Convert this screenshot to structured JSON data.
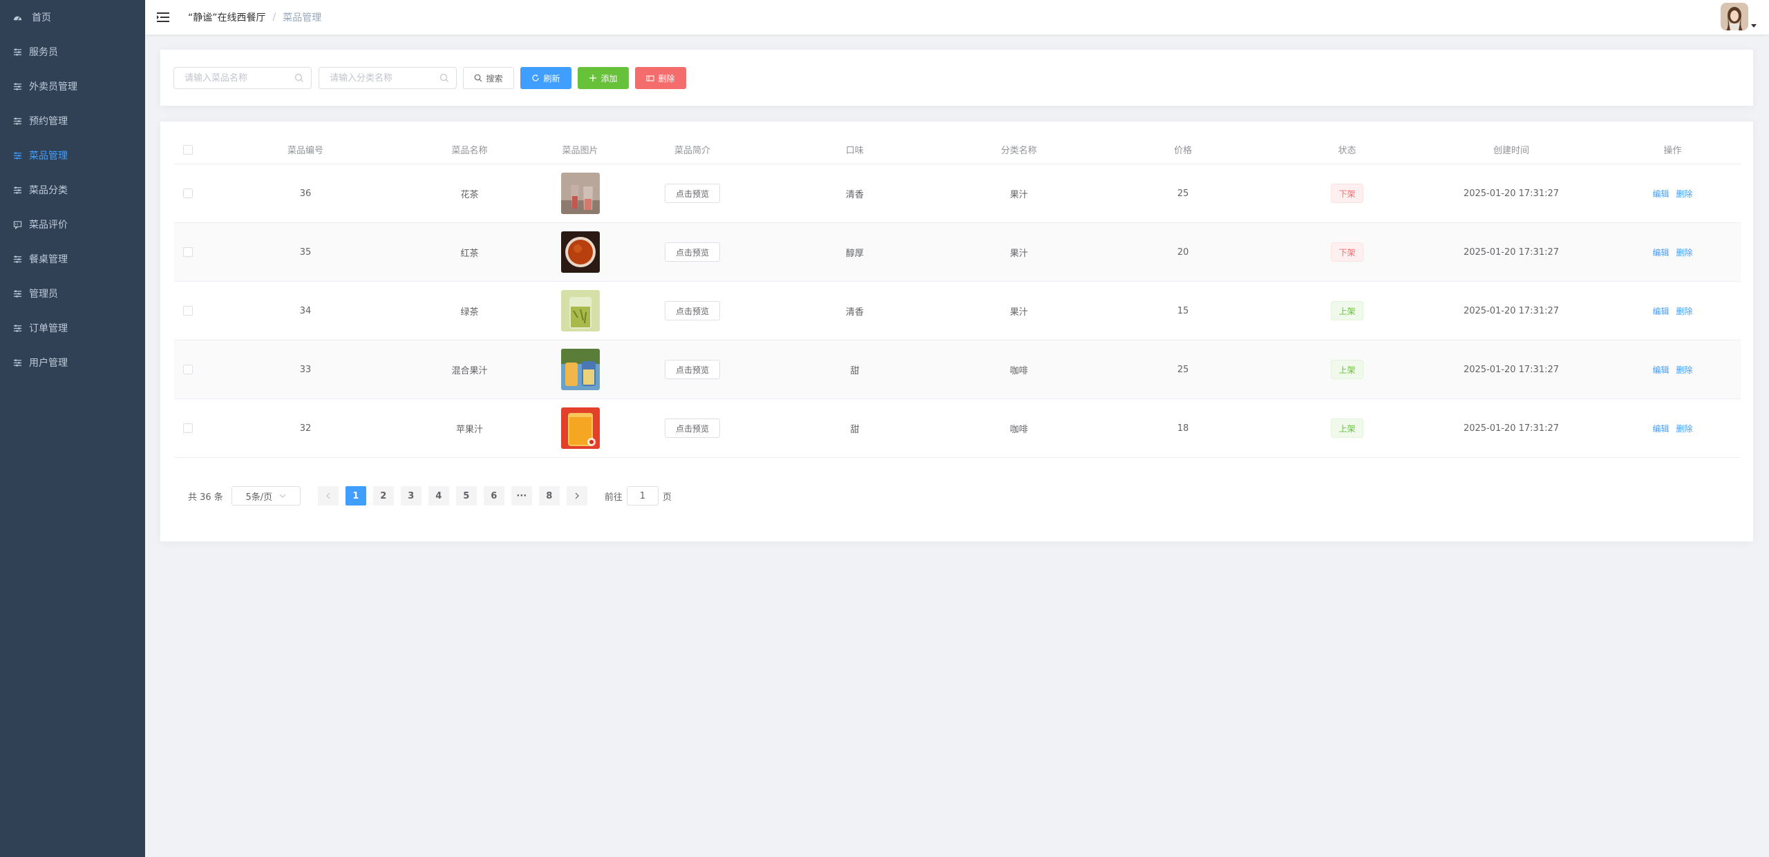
{
  "sidebar": {
    "items": [
      {
        "label": "首页",
        "icon": "dashboard-icon",
        "active": false
      },
      {
        "label": "服务员",
        "icon": "sliders-icon",
        "active": false
      },
      {
        "label": "外卖员管理",
        "icon": "sliders-icon",
        "active": false
      },
      {
        "label": "预约管理",
        "icon": "sliders-icon",
        "active": false
      },
      {
        "label": "菜品管理",
        "icon": "sliders-icon",
        "active": true
      },
      {
        "label": "菜品分类",
        "icon": "sliders-icon",
        "active": false
      },
      {
        "label": "菜品评价",
        "icon": "comment-icon",
        "active": false
      },
      {
        "label": "餐桌管理",
        "icon": "sliders-icon",
        "active": false
      },
      {
        "label": "管理员",
        "icon": "sliders-icon",
        "active": false
      },
      {
        "label": "订单管理",
        "icon": "sliders-icon",
        "active": false
      },
      {
        "label": "用户管理",
        "icon": "sliders-icon",
        "active": false
      }
    ],
    "bg_color": "#304156",
    "active_color": "#409eff"
  },
  "header": {
    "breadcrumb": [
      "“静谧”在线西餐厅",
      "菜品管理"
    ],
    "separator": "/"
  },
  "search": {
    "name_placeholder": "请输入菜品名称",
    "category_placeholder": "请输入分类名称",
    "search_label": "搜索",
    "refresh_label": "刷新",
    "add_label": "添加",
    "delete_label": "删除"
  },
  "table": {
    "headers": [
      "菜品编号",
      "菜品名称",
      "菜品图片",
      "菜品简介",
      "口味",
      "分类名称",
      "价格",
      "状态",
      "创建时间",
      "操作"
    ],
    "preview_label": "点击预览",
    "edit_label": "编辑",
    "delete_label": "删除",
    "rows": [
      {
        "id": "36",
        "name": "花茶",
        "image": "flower-tea-photo",
        "taste": "清香",
        "category": "果汁",
        "price": "25",
        "status": "下架",
        "status_type": "off",
        "created": "2025-01-20 17:31:27"
      },
      {
        "id": "35",
        "name": "红茶",
        "image": "black-tea-photo",
        "taste": "醇厚",
        "category": "果汁",
        "price": "20",
        "status": "下架",
        "status_type": "off",
        "created": "2025-01-20 17:31:27"
      },
      {
        "id": "34",
        "name": "绿茶",
        "image": "green-tea-photo",
        "taste": "清香",
        "category": "果汁",
        "price": "15",
        "status": "上架",
        "status_type": "on",
        "created": "2025-01-20 17:31:27"
      },
      {
        "id": "33",
        "name": "混合果汁",
        "image": "mixed-juice-photo",
        "taste": "甜",
        "category": "咖啡",
        "price": "25",
        "status": "上架",
        "status_type": "on",
        "created": "2025-01-20 17:31:27"
      },
      {
        "id": "32",
        "name": "苹果汁",
        "image": "apple-juice-photo",
        "taste": "甜",
        "category": "咖啡",
        "price": "18",
        "status": "上架",
        "status_type": "on",
        "created": "2025-01-20 17:31:27"
      }
    ]
  },
  "pagination": {
    "total": "共 36 条",
    "page_size": "5条/页",
    "pages": [
      "1",
      "2",
      "3",
      "4",
      "5",
      "6",
      "···",
      "8"
    ],
    "current": "1",
    "goto_prefix": "前往",
    "goto_value": "1",
    "goto_suffix": "页"
  }
}
